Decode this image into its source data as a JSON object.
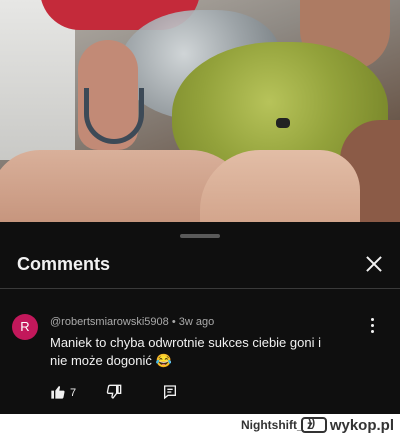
{
  "comments_panel": {
    "title": "Comments",
    "comment": {
      "avatar_letter": "R",
      "avatar_color": "#c2185b",
      "meta": "@robertsmiarowski5908 • 3w ago",
      "text": "Maniek to chyba odwrotnie sukces ciebie goni i nie może dogonić 😂",
      "like_count": "7"
    }
  },
  "watermark": {
    "text": "Nightshift_ z",
    "logo_label": "wykop.pl"
  },
  "icons": [
    "close-icon",
    "more-vert-icon",
    "thumb-up-icon",
    "thumb-down-icon",
    "reply-icon"
  ]
}
